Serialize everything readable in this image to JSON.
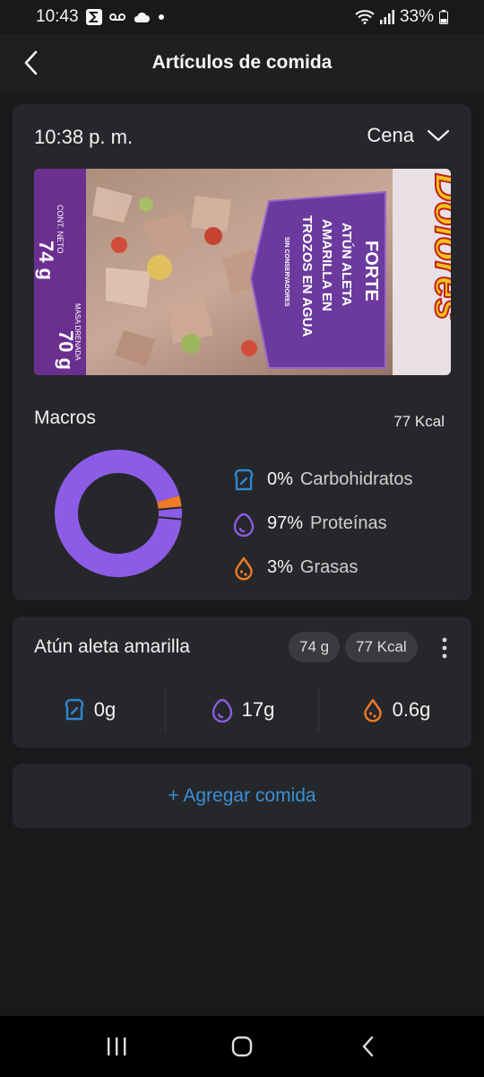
{
  "status_bar": {
    "time": "10:43",
    "battery": "33%",
    "icons": [
      "sigma-app-icon",
      "voicemail-icon",
      "cloud-icon",
      "dot-icon",
      "wifi-icon",
      "signal-icon",
      "battery-icon"
    ]
  },
  "header": {
    "title": "Artículos de comida",
    "back_icon": "chevron-left-icon"
  },
  "meal": {
    "time": "10:38 p. m.",
    "meal_type": "Cena",
    "photo": {
      "brand": "Dolores",
      "line": "FORTE",
      "product_lines": [
        "ATÚN ALETA",
        "AMARILLA EN",
        "TROZOS EN AGUA"
      ],
      "badge": "SIN CONSERVADORES",
      "net_label": "CONT. NETO",
      "net_value": "74 g",
      "drained_label": "MASA DRENADA",
      "drained_value": "70 g"
    },
    "macros_title": "Macros",
    "kcal": "77 Kcal",
    "macros": [
      {
        "icon": "bread-icon",
        "pct": "0%",
        "label": "Carbohidratos",
        "value": 0,
        "color": "#2f86d6"
      },
      {
        "icon": "egg-icon",
        "pct": "97%",
        "label": "Proteínas",
        "value": 97,
        "color": "#8d5ce6"
      },
      {
        "icon": "drop-icon",
        "pct": "3%",
        "label": "Grasas",
        "value": 3,
        "color": "#f07b25"
      }
    ]
  },
  "item": {
    "name": "Atún aleta amarilla",
    "weight": "74 g",
    "kcal": "77 Kcal",
    "carbs": "0g",
    "protein": "17g",
    "fat": "0.6g"
  },
  "add_food": {
    "label": "+ Agregar comida"
  },
  "colors": {
    "background": "#18191b",
    "card": "#26272a",
    "carbs": "#2f86d6",
    "protein": "#8d5ce6",
    "fat": "#f07b25",
    "link": "#3a8fd9"
  }
}
